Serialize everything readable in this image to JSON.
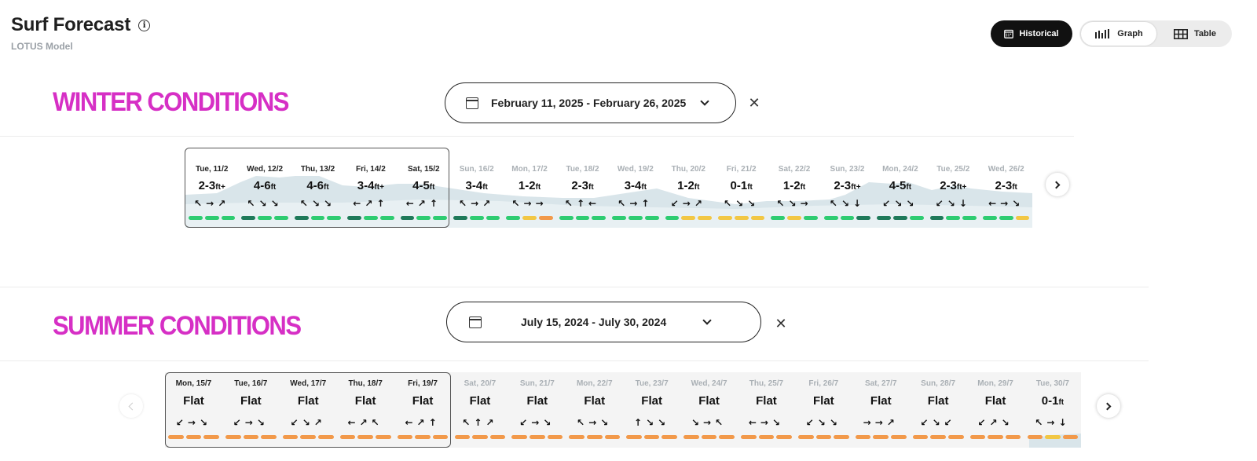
{
  "header": {
    "title": "Surf Forecast",
    "subtitle": "LOTUS Model",
    "info_icon": "info-icon"
  },
  "view_buttons": {
    "historical": "Historical",
    "graph": "Graph",
    "table": "Table"
  },
  "colors": {
    "accent_magenta": "#d62fc5",
    "dark_green": "#1f7a5a",
    "green": "#2ecc71",
    "yellow": "#f2c744",
    "orange": "#f2994a",
    "swell_fill": "#d4e2e8"
  },
  "winter": {
    "title": "WINTER CONDITIONS",
    "date_range": "February 11, 2025 - February 26, 2025",
    "days": [
      {
        "label": "Tue, 11/2",
        "height": "2-3",
        "unit": "ft+",
        "arrows": "↖→↗",
        "bars": [
          "g",
          "g",
          "g"
        ],
        "selected": true
      },
      {
        "label": "Wed, 12/2",
        "height": "4-6",
        "unit": "ft",
        "arrows": "↖↘↘",
        "bars": [
          "d",
          "g",
          "g"
        ],
        "selected": true
      },
      {
        "label": "Thu, 13/2",
        "height": "4-6",
        "unit": "ft",
        "arrows": "↖↘↘",
        "bars": [
          "d",
          "g",
          "g"
        ],
        "selected": true
      },
      {
        "label": "Fri, 14/2",
        "height": "3-4",
        "unit": "ft+",
        "arrows": "←↗↑",
        "bars": [
          "d",
          "g",
          "g"
        ],
        "selected": true
      },
      {
        "label": "Sat, 15/2",
        "height": "4-5",
        "unit": "ft",
        "arrows": "←↗↑",
        "bars": [
          "d",
          "g",
          "g"
        ],
        "selected": true
      },
      {
        "label": "Sun, 16/2",
        "height": "3-4",
        "unit": "ft",
        "arrows": "↖→↗",
        "bars": [
          "d",
          "g",
          "g"
        ],
        "selected": false
      },
      {
        "label": "Mon, 17/2",
        "height": "1-2",
        "unit": "ft",
        "arrows": "↖→→",
        "bars": [
          "g",
          "y",
          "o"
        ],
        "selected": false
      },
      {
        "label": "Tue, 18/2",
        "height": "2-3",
        "unit": "ft",
        "arrows": "↖↑←",
        "bars": [
          "g",
          "g",
          "g"
        ],
        "selected": false
      },
      {
        "label": "Wed, 19/2",
        "height": "3-4",
        "unit": "ft",
        "arrows": "↖→↑",
        "bars": [
          "g",
          "g",
          "g"
        ],
        "selected": false
      },
      {
        "label": "Thu, 20/2",
        "height": "1-2",
        "unit": "ft",
        "arrows": "↙→↗",
        "bars": [
          "g",
          "y",
          "y"
        ],
        "selected": false
      },
      {
        "label": "Fri, 21/2",
        "height": "0-1",
        "unit": "ft",
        "arrows": "↖↘↘",
        "bars": [
          "y",
          "y",
          "y"
        ],
        "selected": false
      },
      {
        "label": "Sat, 22/2",
        "height": "1-2",
        "unit": "ft",
        "arrows": "↖↘→",
        "bars": [
          "g",
          "y",
          "g"
        ],
        "selected": false
      },
      {
        "label": "Sun, 23/2",
        "height": "2-3",
        "unit": "ft+",
        "arrows": "↖↘↓",
        "bars": [
          "g",
          "g",
          "d"
        ],
        "selected": false
      },
      {
        "label": "Mon, 24/2",
        "height": "4-5",
        "unit": "ft",
        "arrows": "↙↘↘",
        "bars": [
          "d",
          "d",
          "g"
        ],
        "selected": false
      },
      {
        "label": "Tue, 25/2",
        "height": "2-3",
        "unit": "ft+",
        "arrows": "↙↘↓",
        "bars": [
          "d",
          "g",
          "g"
        ],
        "selected": false
      },
      {
        "label": "Wed, 26/2",
        "height": "2-3",
        "unit": "ft",
        "arrows": "←→↘",
        "bars": [
          "g",
          "g",
          "y"
        ],
        "selected": false
      }
    ]
  },
  "summer": {
    "title": "SUMMER CONDITIONS",
    "date_range": "July 15, 2024 - July 30, 2024",
    "days": [
      {
        "label": "Mon, 15/7",
        "height": "Flat",
        "unit": "",
        "arrows": "↙→↘",
        "bars": [
          "o",
          "o",
          "o"
        ],
        "selected": true
      },
      {
        "label": "Tue, 16/7",
        "height": "Flat",
        "unit": "",
        "arrows": "↙→↘",
        "bars": [
          "o",
          "o",
          "o"
        ],
        "selected": true
      },
      {
        "label": "Wed, 17/7",
        "height": "Flat",
        "unit": "",
        "arrows": "↙↘↗",
        "bars": [
          "o",
          "o",
          "o"
        ],
        "selected": true
      },
      {
        "label": "Thu, 18/7",
        "height": "Flat",
        "unit": "",
        "arrows": "←↗↖",
        "bars": [
          "o",
          "o",
          "o"
        ],
        "selected": true
      },
      {
        "label": "Fri, 19/7",
        "height": "Flat",
        "unit": "",
        "arrows": "←↗↑",
        "bars": [
          "o",
          "o",
          "o"
        ],
        "selected": true
      },
      {
        "label": "Sat, 20/7",
        "height": "Flat",
        "unit": "",
        "arrows": "↖↑↗",
        "bars": [
          "o",
          "o",
          "o"
        ],
        "selected": false
      },
      {
        "label": "Sun, 21/7",
        "height": "Flat",
        "unit": "",
        "arrows": "↙→↘",
        "bars": [
          "o",
          "o",
          "o"
        ],
        "selected": false
      },
      {
        "label": "Mon, 22/7",
        "height": "Flat",
        "unit": "",
        "arrows": "↖→↘",
        "bars": [
          "o",
          "o",
          "o"
        ],
        "selected": false
      },
      {
        "label": "Tue, 23/7",
        "height": "Flat",
        "unit": "",
        "arrows": "↑↘↘",
        "bars": [
          "o",
          "o",
          "o"
        ],
        "selected": false
      },
      {
        "label": "Wed, 24/7",
        "height": "Flat",
        "unit": "",
        "arrows": "↘→↖",
        "bars": [
          "o",
          "o",
          "o"
        ],
        "selected": false
      },
      {
        "label": "Thu, 25/7",
        "height": "Flat",
        "unit": "",
        "arrows": "←→↘",
        "bars": [
          "o",
          "o",
          "o"
        ],
        "selected": false
      },
      {
        "label": "Fri, 26/7",
        "height": "Flat",
        "unit": "",
        "arrows": "↙↘↘",
        "bars": [
          "o",
          "o",
          "o"
        ],
        "selected": false
      },
      {
        "label": "Sat, 27/7",
        "height": "Flat",
        "unit": "",
        "arrows": "→→↗",
        "bars": [
          "o",
          "o",
          "o"
        ],
        "selected": false
      },
      {
        "label": "Sun, 28/7",
        "height": "Flat",
        "unit": "",
        "arrows": "↙↘↙",
        "bars": [
          "o",
          "o",
          "o"
        ],
        "selected": false
      },
      {
        "label": "Mon, 29/7",
        "height": "Flat",
        "unit": "",
        "arrows": "↙↗↘",
        "bars": [
          "o",
          "o",
          "o"
        ],
        "selected": false
      },
      {
        "label": "Tue, 30/7",
        "height": "0-1",
        "unit": "ft",
        "arrows": "↖→↓",
        "bars": [
          "o",
          "y",
          "o"
        ],
        "selected": false
      }
    ]
  }
}
